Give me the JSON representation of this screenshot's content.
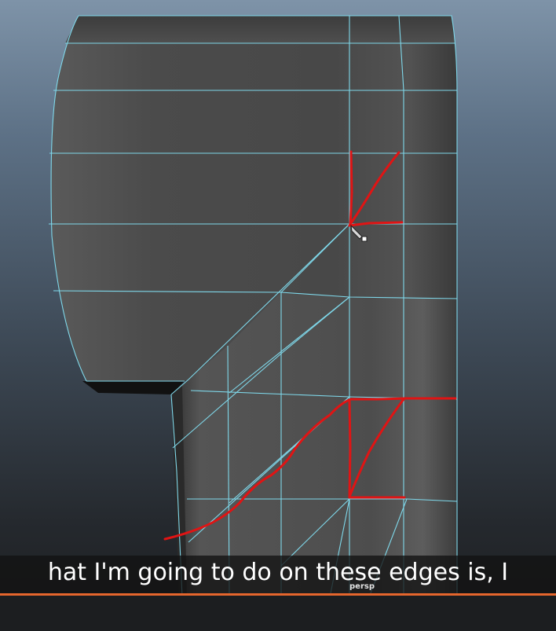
{
  "viewport": {
    "camera": "persp",
    "wire_color": "#7fd8ea",
    "annotation_color": "#e01414"
  },
  "subtitle": {
    "text": "hat I'm going to do on these edges is, I"
  },
  "colors": {
    "timeline": "#e5662d",
    "background_top": "#7e93a8",
    "background_bottom": "#1e2023"
  }
}
